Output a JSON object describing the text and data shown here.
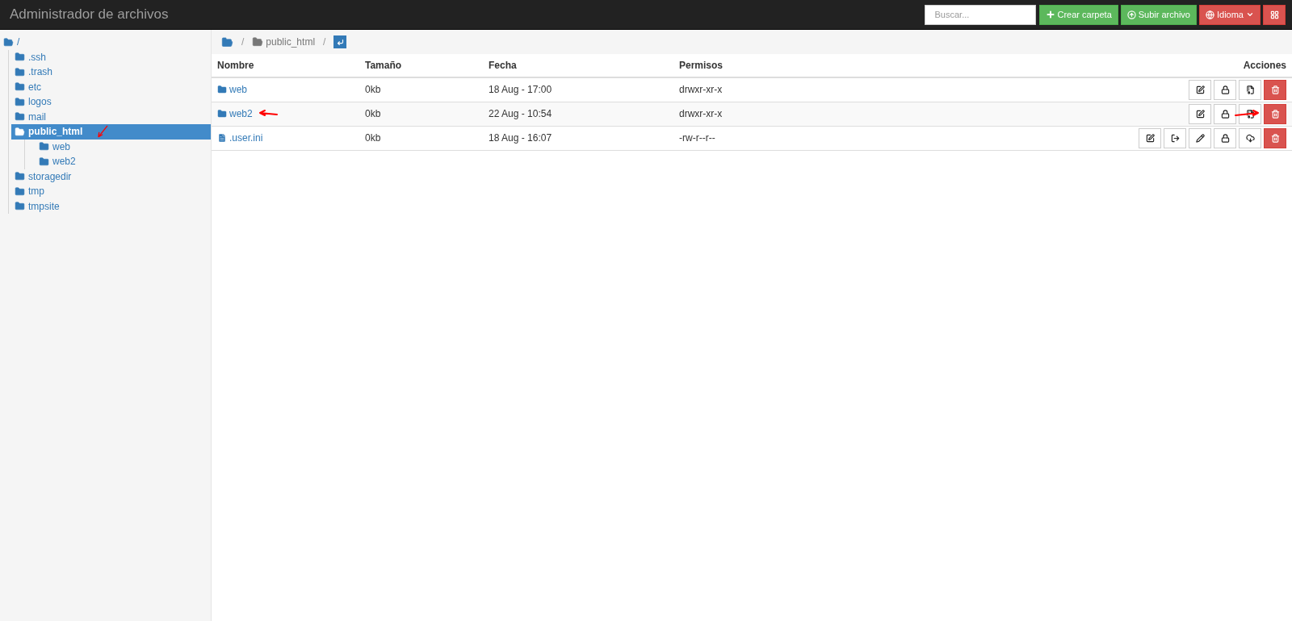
{
  "header": {
    "title": "Administrador de archivos",
    "search": {
      "placeholder": "Buscar..."
    },
    "buttons": [
      {
        "kind": "create",
        "label": "Crear carpeta"
      },
      {
        "kind": "upload",
        "label": "Subir archivo"
      },
      {
        "kind": "language",
        "label": "Idioma"
      },
      {
        "kind": "grid"
      }
    ]
  },
  "tree": {
    "label": "/",
    "expanded": true,
    "selected": false,
    "children": [
      {
        "label": ".ssh",
        "expanded": false,
        "selected": false,
        "arrow_mark": false
      },
      {
        "label": ".trash",
        "expanded": false,
        "selected": false,
        "arrow_mark": false
      },
      {
        "label": "etc",
        "expanded": false,
        "selected": false,
        "arrow_mark": false
      },
      {
        "label": "logos",
        "expanded": false,
        "selected": false,
        "arrow_mark": false
      },
      {
        "label": "mail",
        "expanded": false,
        "selected": false,
        "arrow_mark": false
      },
      {
        "label": "public_html",
        "expanded": true,
        "selected": true,
        "arrow_mark": true,
        "children": [
          {
            "label": "web",
            "expanded": false,
            "selected": false,
            "arrow_mark": false
          },
          {
            "label": "web2",
            "expanded": false,
            "selected": false,
            "arrow_mark": false
          }
        ]
      },
      {
        "label": "storagedir",
        "expanded": false,
        "selected": false,
        "arrow_mark": false
      },
      {
        "label": "tmp",
        "expanded": false,
        "selected": false,
        "arrow_mark": false
      },
      {
        "label": "tmpsite",
        "expanded": false,
        "selected": false,
        "arrow_mark": false
      }
    ]
  },
  "breadcrumb": {
    "separator": "/",
    "items": [
      {
        "kind": "root"
      },
      {
        "kind": "folder",
        "label": "public_html"
      },
      {
        "kind": "up"
      }
    ]
  },
  "table": {
    "columns": [
      "Nombre",
      "Tamaño",
      "Fecha",
      "Permisos",
      "Acciones"
    ],
    "rows": [
      {
        "kind": "folder",
        "name": "web",
        "size": "0kb",
        "date": "18 Aug - 17:00",
        "perms": "drwxr-xr-x",
        "arrow_mark": false,
        "delete_arrow_mark": false,
        "actions": [
          {
            "kind": "rename"
          },
          {
            "kind": "permissions"
          },
          {
            "kind": "compress"
          },
          {
            "kind": "delete"
          }
        ]
      },
      {
        "kind": "folder",
        "name": "web2",
        "size": "0kb",
        "date": "22 Aug - 10:54",
        "perms": "drwxr-xr-x",
        "arrow_mark": true,
        "delete_arrow_mark": true,
        "actions": [
          {
            "kind": "rename"
          },
          {
            "kind": "permissions"
          },
          {
            "kind": "compress"
          },
          {
            "kind": "delete"
          }
        ]
      },
      {
        "kind": "file",
        "name": ".user.ini",
        "size": "0kb",
        "date": "18 Aug - 16:07",
        "perms": "-rw-r--r--",
        "arrow_mark": false,
        "delete_arrow_mark": false,
        "actions": [
          {
            "kind": "rename"
          },
          {
            "kind": "move"
          },
          {
            "kind": "edit"
          },
          {
            "kind": "permissions"
          },
          {
            "kind": "download"
          },
          {
            "kind": "delete"
          }
        ]
      }
    ]
  }
}
